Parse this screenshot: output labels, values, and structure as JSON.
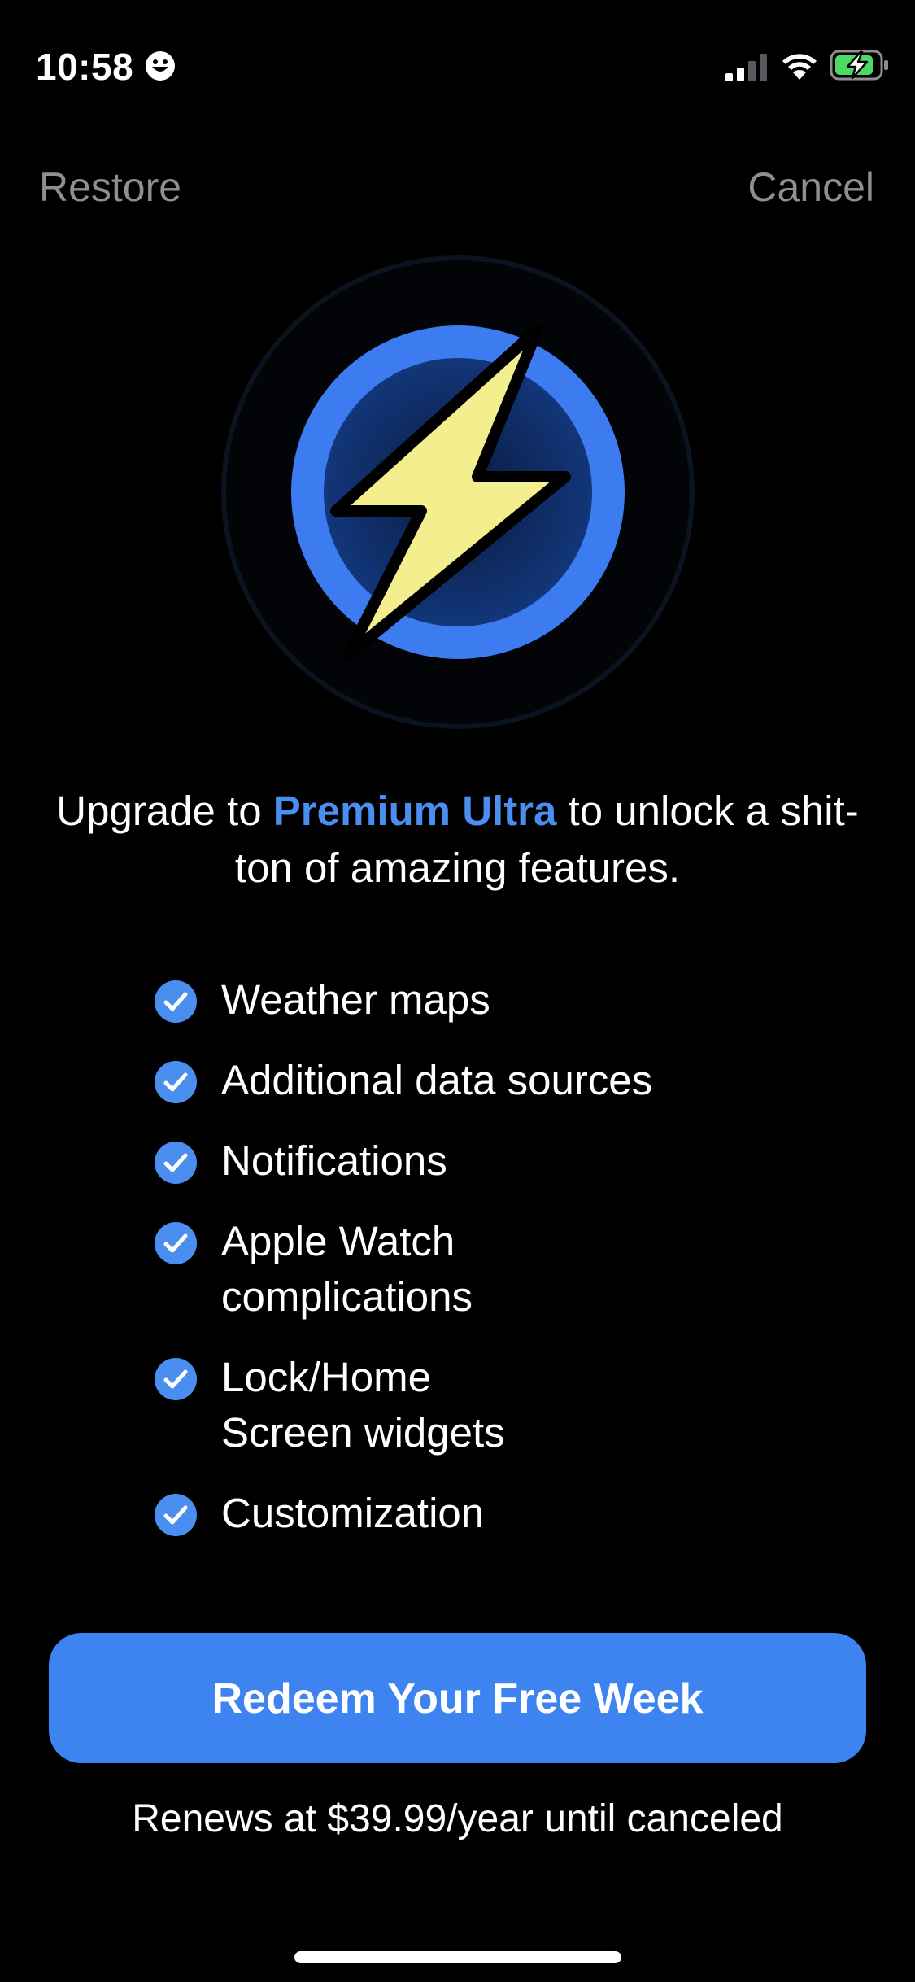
{
  "status_bar": {
    "time": "10:58",
    "icons": [
      "smiley-icon",
      "signal-icon",
      "wifi-icon",
      "battery-charging-icon"
    ]
  },
  "nav": {
    "restore_label": "Restore",
    "cancel_label": "Cancel"
  },
  "logo": {
    "icon": "lightning-bolt-icon",
    "colors": {
      "ring": "#3c7cf0",
      "inner": "#0d2a60",
      "bolt": "#f3ee8e"
    }
  },
  "headline": {
    "prefix": "Upgrade to ",
    "accent": "Premium Ultra",
    "suffix": " to unlock a shit-ton of amazing features."
  },
  "features": [
    {
      "label": "Weather maps"
    },
    {
      "label": "Additional data sources"
    },
    {
      "label": "Notifications"
    },
    {
      "label": "Apple Watch\ncomplications"
    },
    {
      "label": "Lock/Home\nScreen widgets"
    },
    {
      "label": "Customization"
    }
  ],
  "cta": {
    "label": "Redeem Your Free Week"
  },
  "renewal_text": "Renews at $39.99/year until canceled",
  "colors": {
    "accent": "#4a8ef0",
    "button": "#3d84f0",
    "background": "#000000",
    "muted": "#8e8e93"
  }
}
